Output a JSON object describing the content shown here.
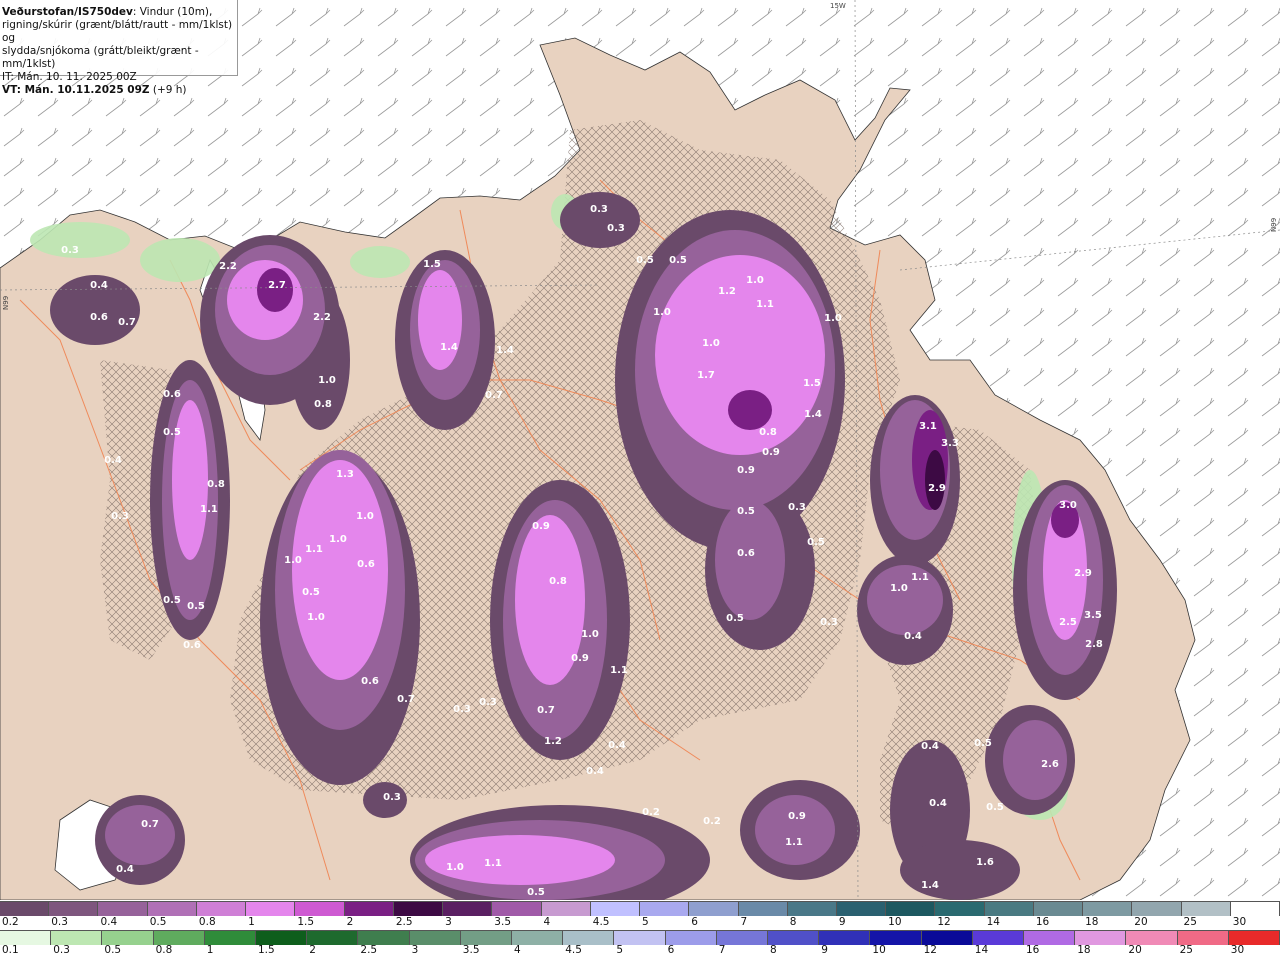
{
  "header": {
    "title_bold": "Veðurstofan/IS750dev",
    "title_rest": ": Vindur (10m),",
    "line2": "rigning/skúrir (grænt/blátt/rautt - mm/1klst) og",
    "line3": "slydda/snjókoma (grátt/bleikt/grænt - mm/1klst)",
    "it": "IT: Mán. 10. 11. 2025 00Z",
    "vt_bold": "VT: Mán. 10.11.2025 09Z",
    "vt_rest": " (+9 h)"
  },
  "map": {
    "grid_label_top": "15W",
    "grid_label_left": "N99",
    "grid_label_right": "N99",
    "colors": {
      "sea": "#ffffff",
      "land": "#e8d2c0",
      "road": "#ef8a5a",
      "hatch": "#7a6a62"
    },
    "values": [
      "0.3",
      "0.4",
      "0.6",
      "0.7",
      "2.2",
      "2.7",
      "2.2",
      "1.0",
      "0.8",
      "1.5",
      "1.4",
      "1.4",
      "0.7",
      "0.3",
      "0.3",
      "0.5",
      "0.5",
      "1.2",
      "1.0",
      "1.1",
      "1.0",
      "1.0",
      "1.0",
      "1.7",
      "1.5",
      "1.4",
      "0.8",
      "0.9",
      "0.9",
      "0.5",
      "0.6",
      "0.5",
      "0.3",
      "0.5",
      "3.1",
      "3.3",
      "2.9",
      "1.1",
      "1.0",
      "0.4",
      "3.0",
      "2.9",
      "2.5",
      "3.5",
      "2.8",
      "2.6",
      "0.5",
      "0.5",
      "0.6",
      "0.5",
      "0.8",
      "1.1",
      "0.3",
      "0.4",
      "0.5",
      "0.5",
      "0.6",
      "1.3",
      "1.0",
      "1.1",
      "1.0",
      "1.0",
      "0.6",
      "0.5",
      "1.0",
      "0.6",
      "0.7",
      "0.3",
      "0.3",
      "0.9",
      "0.8",
      "1.0",
      "0.9",
      "1.1",
      "0.7",
      "1.2",
      "0.4",
      "0.4",
      "0.3",
      "0.7",
      "0.4",
      "0.2",
      "0.9",
      "1.1",
      "0.2",
      "1.0",
      "1.1",
      "0.5",
      "1.4",
      "1.6",
      "0.4",
      "0.4",
      "0.3"
    ]
  },
  "legend_top": {
    "labels": [
      "0.2",
      "0.3",
      "0.4",
      "0.5",
      "0.8",
      "1",
      "1.5",
      "2",
      "2.5",
      "3",
      "3.5",
      "4",
      "4.5",
      "5",
      "6",
      "7",
      "8",
      "9",
      "10",
      "12",
      "14",
      "16",
      "18",
      "20",
      "25",
      "30"
    ],
    "colors": [
      "#6a4a6a",
      "#7e567e",
      "#96629a",
      "#b070b6",
      "#cf7fd6",
      "#e486ec",
      "#ce5ad2",
      "#7a1f84",
      "#3d0a44",
      "#5a1f62",
      "#a05aa8",
      "#c79ad0",
      "#c0c0ff",
      "#a9a9ef",
      "#8f9fcf",
      "#6a8aa8",
      "#4a7888",
      "#2a6070",
      "#1d5860",
      "#2a6a70",
      "#4a7a82",
      "#6a8a92",
      "#7e9aa2",
      "#92a6ae",
      "#b2c0c6",
      "#ffffff"
    ]
  },
  "legend_bottom": {
    "labels": [
      "0.1",
      "0.3",
      "0.5",
      "0.8",
      "1",
      "1.5",
      "2",
      "2.5",
      "3",
      "3.5",
      "4",
      "4.5",
      "5",
      "6",
      "7",
      "8",
      "9",
      "10",
      "12",
      "14",
      "16",
      "18",
      "20",
      "25",
      "30"
    ],
    "colors": [
      "#e6f8e2",
      "#bde7b2",
      "#96d18e",
      "#5fab5e",
      "#2f8c3a",
      "#0e5e1c",
      "#1e6a2e",
      "#3f7e4e",
      "#5a8e6a",
      "#739e86",
      "#8eb0a6",
      "#a9bfc8",
      "#c2c2f2",
      "#9c9cea",
      "#7676d8",
      "#5050c8",
      "#3030b8",
      "#1414a8",
      "#0a0a98",
      "#5a3ad8",
      "#b06ae4",
      "#e098e0",
      "#f08ab6",
      "#f06a86",
      "#e82a2a"
    ]
  }
}
